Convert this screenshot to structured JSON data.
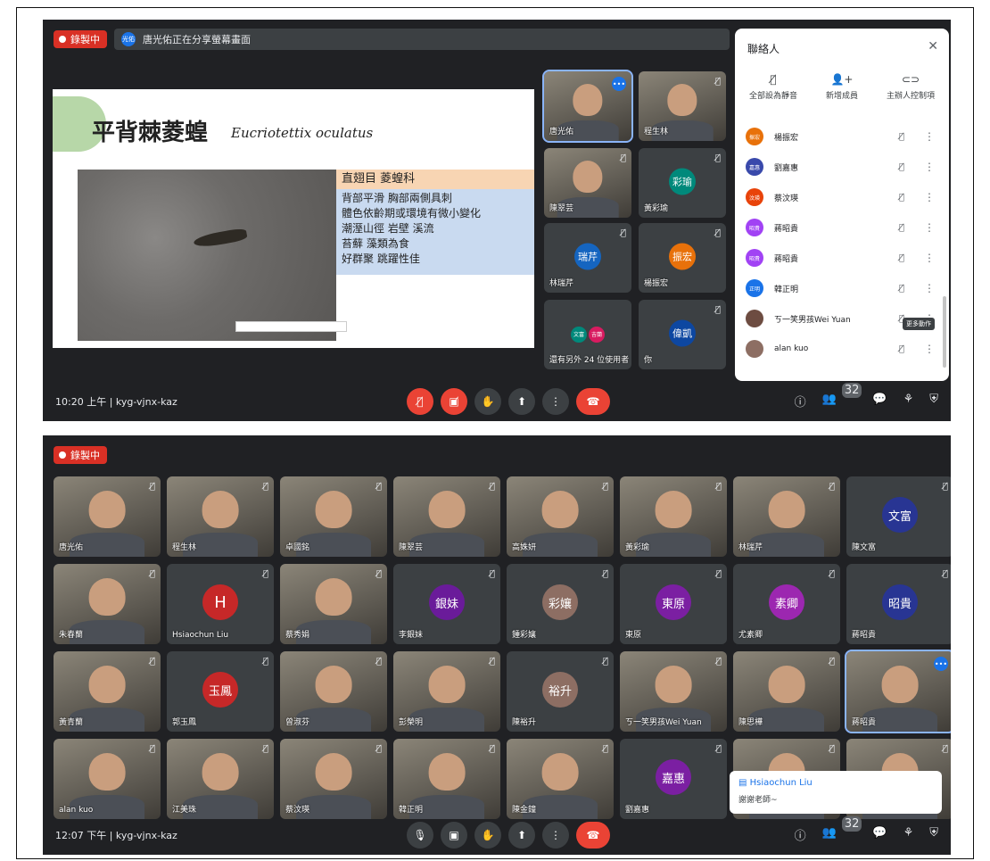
{
  "recording_label": "錄製中",
  "screen1": {
    "presenter_initials": "光佑",
    "presenting_text": "唐光佑正在分享螢幕畫面",
    "slide": {
      "title": "平背棘菱蝗",
      "latin": "Eucriotettix oculatus",
      "order": "直翅目 菱蝗科",
      "desc": [
        "背部平滑 胸部兩側具刺",
        "體色依齡期或環境有微小變化",
        "潮溼山徑 岩壁 溪流",
        "苔蘚 藻類為食",
        "好群聚 跳躍性佳"
      ]
    },
    "tiles": [
      {
        "name": "唐光佑"
      },
      {
        "name": "程生林"
      },
      {
        "name": "陳翠芸"
      },
      {
        "name": "黃彩瑜",
        "initials": "彩瑜"
      },
      {
        "name": "林瑞芹",
        "initials": "瑞芹"
      },
      {
        "name": "楊振宏",
        "initials": "振宏"
      },
      {
        "name": "還有另外 24 位使用者",
        "chips": [
          "文富",
          "吉蘭"
        ]
      },
      {
        "name": "你",
        "initials": "偉凱"
      }
    ],
    "people_panel": {
      "title": "聯絡人",
      "actions": [
        "全部設為靜音",
        "新增成員",
        "主辦人控制項"
      ],
      "list": [
        {
          "initials": "振宏",
          "name": "楊振宏",
          "color": "#e8710a"
        },
        {
          "initials": "嘉惠",
          "name": "劉嘉惠",
          "color": "#3949ab"
        },
        {
          "initials": "汶瑛",
          "name": "蔡汶瑛",
          "color": "#e8430a"
        },
        {
          "initials": "昭貴",
          "name": "蔣昭貴",
          "color": "#a142f4"
        },
        {
          "initials": "昭貴",
          "name": "蔣昭貴",
          "color": "#a142f4"
        },
        {
          "initials": "正明",
          "name": "韓正明",
          "color": "#1a73e8"
        },
        {
          "initials": "",
          "name": "ㄎ一笑男孩Wei Yuan",
          "color": "#6d4c41"
        },
        {
          "initials": "",
          "name": "alan kuo",
          "color": "#8d6e63"
        }
      ],
      "tooltip": "更多動作"
    },
    "time": "10:20 上午",
    "meeting_code": "kyg-vjnx-kaz",
    "people_count": "32"
  },
  "screen2": {
    "tiles": [
      {
        "name": "唐光佑"
      },
      {
        "name": "程生林"
      },
      {
        "name": "卓國銘"
      },
      {
        "name": "陳翠芸"
      },
      {
        "name": "高姝妍"
      },
      {
        "name": "黃彩瑜"
      },
      {
        "name": "林瑞芹"
      },
      {
        "name": "陳文富",
        "initials": "文富"
      },
      {
        "name": "朱春蘭"
      },
      {
        "name": "Hsiaochun Liu",
        "initials": "H"
      },
      {
        "name": "蔡秀娟"
      },
      {
        "name": "李銀妹",
        "initials": "銀妹"
      },
      {
        "name": "鍾彩孃",
        "initials": "彩孃"
      },
      {
        "name": "東原",
        "initials": "東原"
      },
      {
        "name": "尤素卿",
        "initials": "素卿"
      },
      {
        "name": "蔣昭貴",
        "initials": "昭貴"
      },
      {
        "name": "黃青蘭"
      },
      {
        "name": "郭玉鳳",
        "initials": "玉鳳"
      },
      {
        "name": "曾淑芬"
      },
      {
        "name": "彭榮明"
      },
      {
        "name": "陳裕升",
        "initials": "裕升"
      },
      {
        "name": "ㄎ一笑男孩Wei Yuan"
      },
      {
        "name": "陳思樺"
      },
      {
        "name": "蔣昭貴"
      },
      {
        "name": "alan kuo"
      },
      {
        "name": "江美珠"
      },
      {
        "name": "蔡汶瑛"
      },
      {
        "name": "韓正明"
      },
      {
        "name": "陳金鐘"
      },
      {
        "name": "劉嘉惠",
        "initials": "嘉惠"
      },
      {
        "name": ""
      },
      {
        "name": ""
      }
    ],
    "chat_toast": {
      "sender": "Hsiaochun Liu",
      "message": "謝謝老師~"
    },
    "time": "12:07 下午",
    "meeting_code": "kyg-vjnx-kaz",
    "people_count": "32"
  },
  "colors": {
    "meet_bg": "#202124",
    "tile_bg": "#3c4043",
    "red": "#ea4335",
    "accent": "#1a73e8"
  }
}
